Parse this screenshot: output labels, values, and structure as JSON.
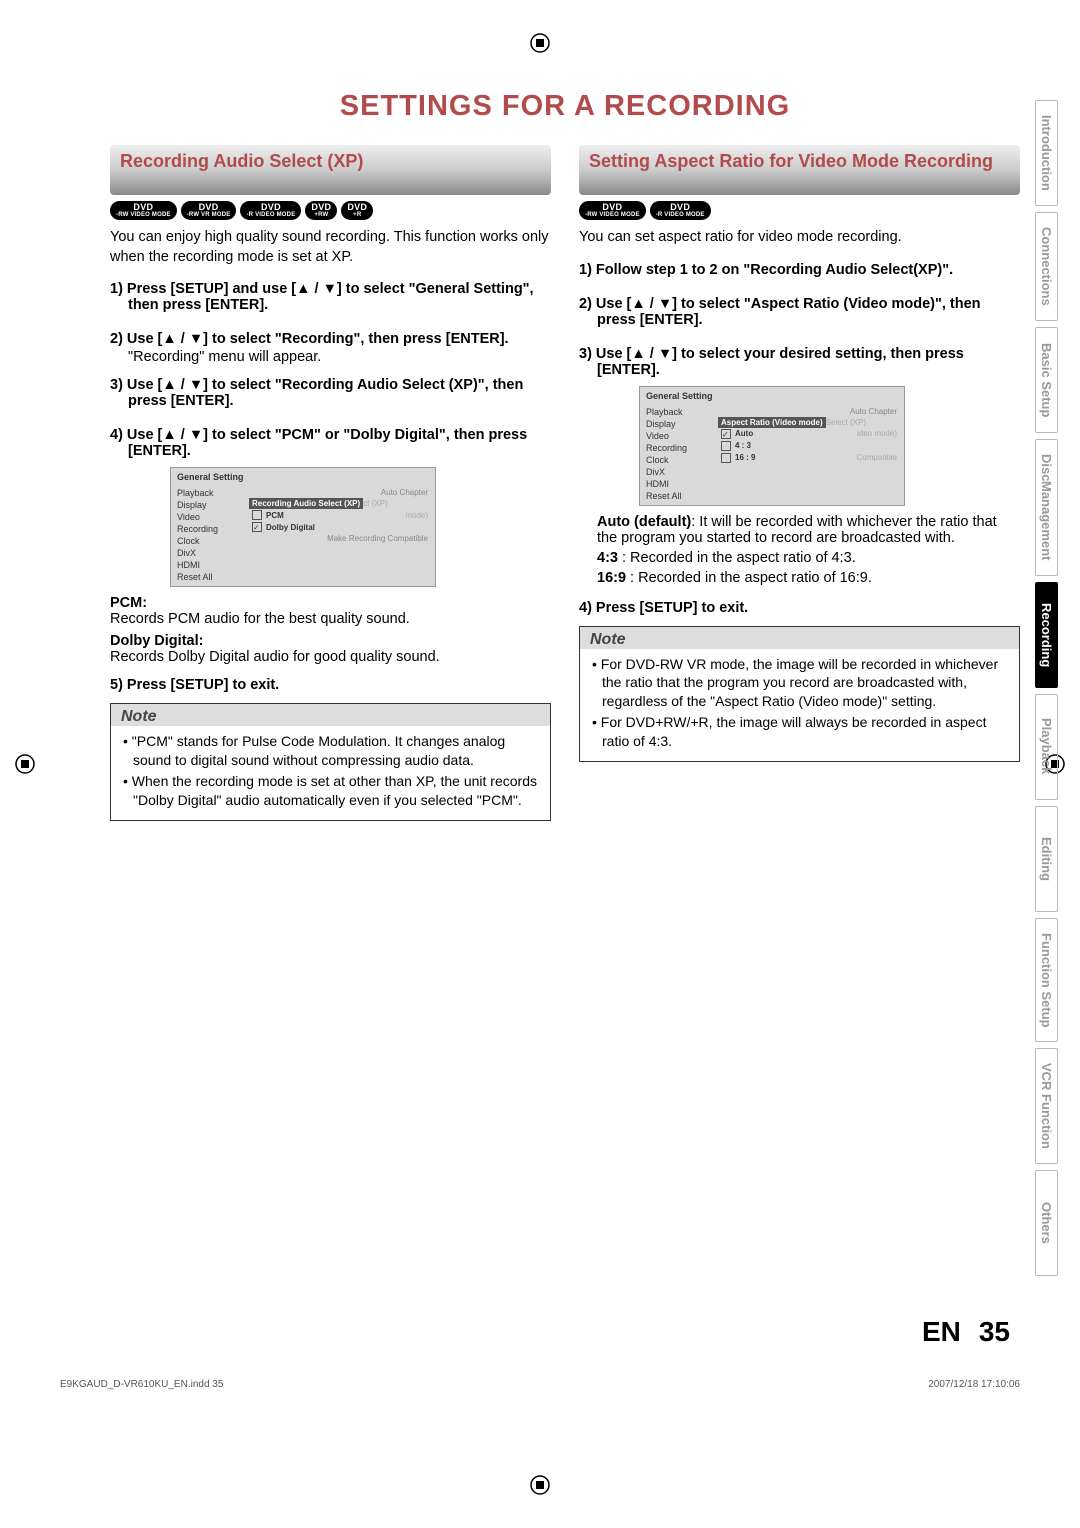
{
  "page_title": "SETTINGS FOR A RECORDING",
  "side_tabs": {
    "items": [
      {
        "label": "Introduction",
        "active": false
      },
      {
        "label": "Connections",
        "active": false
      },
      {
        "label": "Basic Setup",
        "active": false
      },
      {
        "label_line1": "Disc",
        "label_line2": "Management",
        "two_line": true,
        "active": false
      },
      {
        "label": "Recording",
        "active": true
      },
      {
        "label": "Playback",
        "active": false
      },
      {
        "label": "Editing",
        "active": false
      },
      {
        "label": "Function Setup",
        "active": false
      },
      {
        "label": "VCR Function",
        "active": false
      },
      {
        "label": "Others",
        "active": false
      }
    ]
  },
  "left": {
    "header": "Recording Audio Select (XP)",
    "badges": [
      {
        "top": "DVD",
        "bot": "-RW VIDEO MODE"
      },
      {
        "top": "DVD",
        "bot": "-RW VR MODE"
      },
      {
        "top": "DVD",
        "bot": "-R VIDEO MODE"
      },
      {
        "top": "DVD",
        "bot": "+RW"
      },
      {
        "top": "DVD",
        "bot": "+R"
      }
    ],
    "intro": "You can enjoy high quality sound recording. This function works only when the recording mode is set at XP.",
    "steps": {
      "s1": "1) Press [SETUP] and use [▲ / ▼] to select \"General Setting\", then press [ENTER].",
      "s2": "2) Use [▲ / ▼] to select \"Recording\", then press [ENTER].",
      "s2_sub": "\"Recording\" menu will appear.",
      "s3": "3) Use [▲ / ▼] to select \"Recording Audio Select (XP)\", then press [ENTER].",
      "s4": "4) Use [▲ / ▼] to select \"PCM\" or \"Dolby Digital\", then press [ENTER]."
    },
    "osd": {
      "title": "General Setting",
      "menu": [
        "Playback",
        "Display",
        "Video",
        "Recording",
        "Clock",
        "DivX",
        "HDMI",
        "Reset All"
      ],
      "highlight": "Recording Audio Select (XP)",
      "top_grey": "Auto Chapter",
      "right_hint1": "ct (XP)",
      "right_hint2": "mode)",
      "bottom_grey": "Make Recording Compatible",
      "opts": [
        {
          "label": "PCM",
          "checked": false
        },
        {
          "label": "Dolby Digital",
          "checked": true
        }
      ]
    },
    "defs": {
      "pcm_label": "PCM:",
      "pcm_text": "Records PCM audio for the best quality sound.",
      "dd_label": "Dolby Digital:",
      "dd_text": "Records Dolby Digital audio for good quality sound."
    },
    "step5": "5) Press [SETUP] to exit.",
    "note": {
      "title": "Note",
      "b1": "• \"PCM\" stands for Pulse Code Modulation. It changes analog sound to digital sound without compressing audio data.",
      "b2": "• When the recording mode is set at other than XP, the unit records \"Dolby Digital\" audio automatically even if you selected \"PCM\"."
    }
  },
  "right": {
    "header": "Setting Aspect Ratio for Video Mode Recording",
    "badges": [
      {
        "top": "DVD",
        "bot": "-RW VIDEO MODE"
      },
      {
        "top": "DVD",
        "bot": "-R VIDEO MODE"
      }
    ],
    "intro": "You can set aspect ratio for video mode recording.",
    "steps": {
      "s1": "1) Follow step 1 to 2 on \"Recording Audio Select(XP)\".",
      "s2": "2) Use [▲ / ▼] to select \"Aspect Ratio (Video mode)\", then press [ENTER].",
      "s3": "3) Use [▲ / ▼] to select your desired setting, then press [ENTER]."
    },
    "osd": {
      "title": "General Setting",
      "menu": [
        "Playback",
        "Display",
        "Video",
        "Recording",
        "Clock",
        "DivX",
        "HDMI",
        "Reset All"
      ],
      "top_grey": "Auto Chapter",
      "highlight": "Aspect Ratio (Video mode)",
      "right_hint1": "Select (XP)",
      "right_hint2": "ideo mode)",
      "bottom_grey": "Compatible",
      "opts": [
        {
          "label": "Auto",
          "checked": true
        },
        {
          "label": "4 : 3",
          "checked": false
        },
        {
          "label": "16 : 9",
          "checked": false
        }
      ]
    },
    "desc": {
      "auto_label": "Auto (default)",
      "auto_text": ": It will be recorded with whichever the ratio that the program you started to record are broadcasted with.",
      "r43_label": "4:3",
      "r43_text": " :    Recorded in the aspect ratio of 4:3.",
      "r169_label": "16:9",
      "r169_text": " :  Recorded in the aspect ratio of 16:9."
    },
    "step4": "4) Press [SETUP] to exit.",
    "note": {
      "title": "Note",
      "b1": "• For DVD-RW VR mode, the image will be recorded in whichever the ratio that the program you record are broadcasted with, regardless of the \"Aspect Ratio (Video mode)\" setting.",
      "b2": "• For DVD+RW/+R, the image will always be recorded in aspect ratio of 4:3."
    }
  },
  "page_number": {
    "lang": "EN",
    "num": "35"
  },
  "footer": {
    "left": "E9KGAUD_D-VR610KU_EN.indd   35",
    "right": "2007/12/18   17:10:06"
  }
}
